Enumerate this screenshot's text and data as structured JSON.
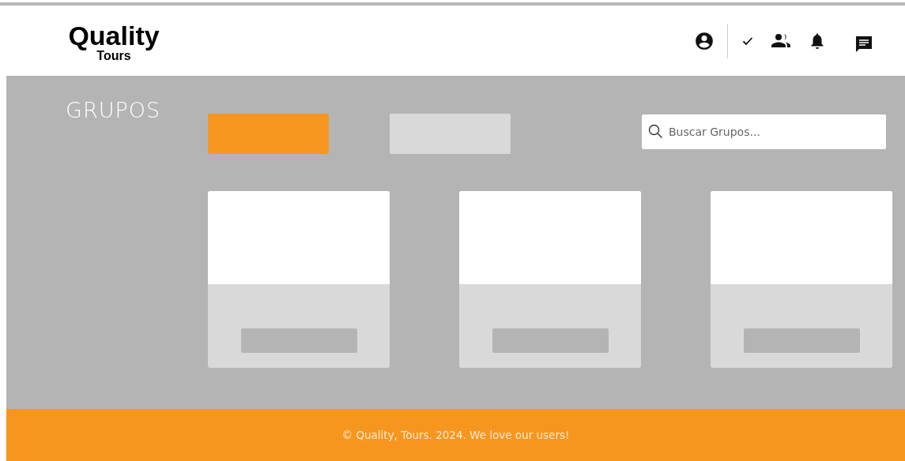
{
  "header": {
    "logo_title": "Quality",
    "logo_subtitle": "Tours"
  },
  "sidebar": {
    "heading": "GRUPOS"
  },
  "tabs": [
    {
      "selected": true
    },
    {
      "selected": false
    }
  ],
  "search": {
    "placeholder": "Buscar Grupos..."
  },
  "group_cards": [
    {
      "kind": "placeholder"
    },
    {
      "kind": "placeholder"
    },
    {
      "kind": "placeholder"
    }
  ],
  "footer": {
    "text": "© Quality, Tours. 2024. We love our users!"
  }
}
